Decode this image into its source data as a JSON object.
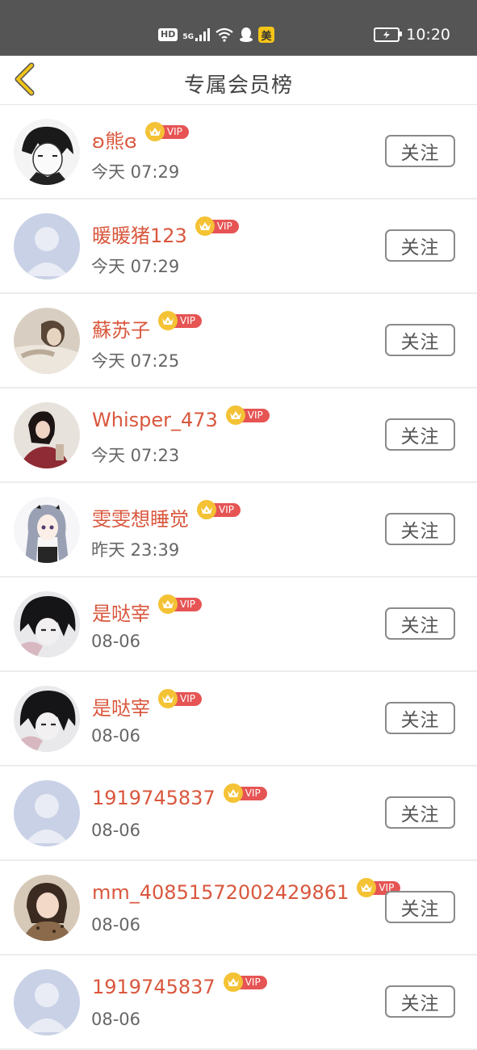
{
  "status_bar": {
    "hd": "HD",
    "network": "5G",
    "meituan": "美",
    "time": "10:20",
    "icons": [
      "hd-icon",
      "signal-icon",
      "wifi-icon",
      "qq-icon",
      "meituan-icon",
      "battery-charging-icon"
    ]
  },
  "nav": {
    "title": "专属会员榜",
    "back_icon": "chevron-left-icon"
  },
  "vip_label": "VIP",
  "follow_label": "关注",
  "colors": {
    "name": "#d9573d",
    "vip_badge": "#e65454",
    "crown": "#f4c234",
    "back_arrow": "#f0c419"
  },
  "members": [
    {
      "name": "ʚ熊ɞ",
      "time": "今天 07:29",
      "avatar": "anime-boy-sketch"
    },
    {
      "name": "暖暖猪123",
      "time": "今天 07:29",
      "avatar": "default-avatar"
    },
    {
      "name": "蘇苏子",
      "time": "今天 07:25",
      "avatar": "anime-lying"
    },
    {
      "name": "Whisper_473",
      "time": "今天 07:23",
      "avatar": "girl-photo"
    },
    {
      "name": "雯雯想睡觉",
      "time": "昨天 23:39",
      "avatar": "anime-girl-silver"
    },
    {
      "name": "是哒宰",
      "time": "08-06",
      "avatar": "anime-dark-hair"
    },
    {
      "name": "是哒宰",
      "time": "08-06",
      "avatar": "anime-dark-hair"
    },
    {
      "name": "1919745837",
      "time": "08-06",
      "avatar": "default-avatar"
    },
    {
      "name": "mm_40851572002429861",
      "time": "08-06",
      "avatar": "girl-photo-2"
    },
    {
      "name": "1919745837",
      "time": "08-06",
      "avatar": "default-avatar"
    }
  ]
}
